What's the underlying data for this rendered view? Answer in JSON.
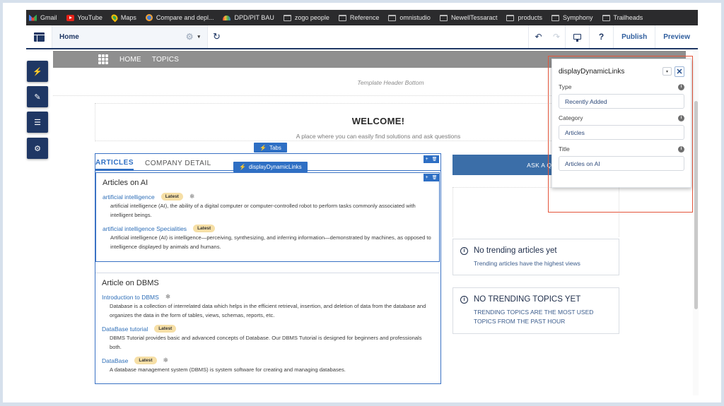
{
  "bookmarks": [
    {
      "label": "Gmail",
      "icon": "gmail-icon"
    },
    {
      "label": "YouTube",
      "icon": "youtube-icon"
    },
    {
      "label": "Maps",
      "icon": "maps-icon"
    },
    {
      "label": "Compare and depl...",
      "icon": "compare-icon"
    },
    {
      "label": "DPD/PIT BAU",
      "icon": "dpd-icon"
    },
    {
      "label": "zogo people",
      "icon": "folder-icon"
    },
    {
      "label": "Reference",
      "icon": "folder-icon"
    },
    {
      "label": "omnistudio",
      "icon": "folder-icon"
    },
    {
      "label": "NewellTessaract",
      "icon": "folder-icon"
    },
    {
      "label": "products",
      "icon": "folder-icon"
    },
    {
      "label": "Symphony",
      "icon": "folder-icon"
    },
    {
      "label": "Trailheads",
      "icon": "folder-icon"
    }
  ],
  "header": {
    "page_name": "Home",
    "gear_glyph": "⚙",
    "caret_glyph": "▾",
    "refresh_glyph": "↻",
    "undo_glyph": "↶",
    "redo_glyph": "↷",
    "device_glyph": "🖵",
    "help_glyph": "?",
    "publish_label": "Publish",
    "preview_label": "Preview"
  },
  "rail": [
    {
      "name": "components",
      "glyph": "⚡"
    },
    {
      "name": "theme",
      "glyph": "✎"
    },
    {
      "name": "page-structure",
      "glyph": "☰"
    },
    {
      "name": "settings",
      "glyph": "⚙"
    }
  ],
  "site_nav": {
    "items": [
      "HOME",
      "TOPICS"
    ]
  },
  "template_header_label": "Template Header Bottom",
  "welcome": {
    "title": "WELCOME!",
    "subtitle": "A place where you can easily find solutions and ask questions"
  },
  "component_tags": {
    "tabs": "Tabs",
    "ddl": "displayDynamicLinks",
    "bolt": "⚡"
  },
  "tabs": [
    {
      "label": "ARTICLES",
      "active": true
    },
    {
      "label": "COMPANY DETAIL",
      "active": false
    }
  ],
  "tool_icons": {
    "add": "+",
    "delete": "🗑"
  },
  "sections": [
    {
      "title": "Articles on AI",
      "articles": [
        {
          "title": "artificial intelligence",
          "badge": "Latest",
          "snowflake": true,
          "description": "artificial intelligence (AI), the ability of a digital computer or computer-controlled robot to perform tasks commonly associated with intelligent beings."
        },
        {
          "title": "artificial intelligence Specialities",
          "badge": "Latest",
          "snowflake": false,
          "description": "Artificial intelligence (AI) is intelligence—perceiving, synthesizing, and inferring information—demonstrated by machines, as opposed to intelligence displayed by animals and humans."
        }
      ]
    },
    {
      "title": "Article on DBMS",
      "articles": [
        {
          "title": "Introduction to DBMS",
          "badge": null,
          "snowflake": true,
          "description": "Database is a collection of interrelated data which helps in the efficient retrieval, insertion, and deletion of data from the database and organizes the data in the form of tables, views, schemas, reports, etc."
        },
        {
          "title": "DataBase tutorial",
          "badge": "Latest",
          "snowflake": false,
          "description": "DBMS Tutorial provides basic and advanced concepts of Database. Our DBMS Tutorial is designed for beginners and professionals both."
        },
        {
          "title": "DataBase",
          "badge": "Latest",
          "snowflake": true,
          "description": "A database management system (DBMS) is system software for creating and managing databases."
        }
      ]
    }
  ],
  "snowflake_glyph": "❄",
  "ask_button_label": "ASK A QUESTI",
  "trending_articles": {
    "title": "No trending articles yet",
    "subtitle": "Trending articles have the highest views"
  },
  "trending_topics": {
    "title": "NO TRENDING TOPICS YET",
    "subtitle": "TRENDING TOPICS ARE THE MOST USED TOPICS FROM THE PAST HOUR"
  },
  "property_panel": {
    "title": "displayDynamicLinks",
    "caret_glyph": "▾",
    "close_glyph": "✕",
    "info_glyph": "i",
    "fields": [
      {
        "label": "Type",
        "value": "Recently Added"
      },
      {
        "label": "Category",
        "value": "Articles"
      },
      {
        "label": "Title",
        "value": "Articles on AI"
      }
    ]
  },
  "colors": {
    "navy": "#1f3764",
    "selection_blue": "#2e6fc4",
    "ask_button": "#3b6ea8",
    "highlight_red": "#e4553b",
    "badge_bg": "#f6dfa6",
    "link": "#2f6fb8"
  }
}
